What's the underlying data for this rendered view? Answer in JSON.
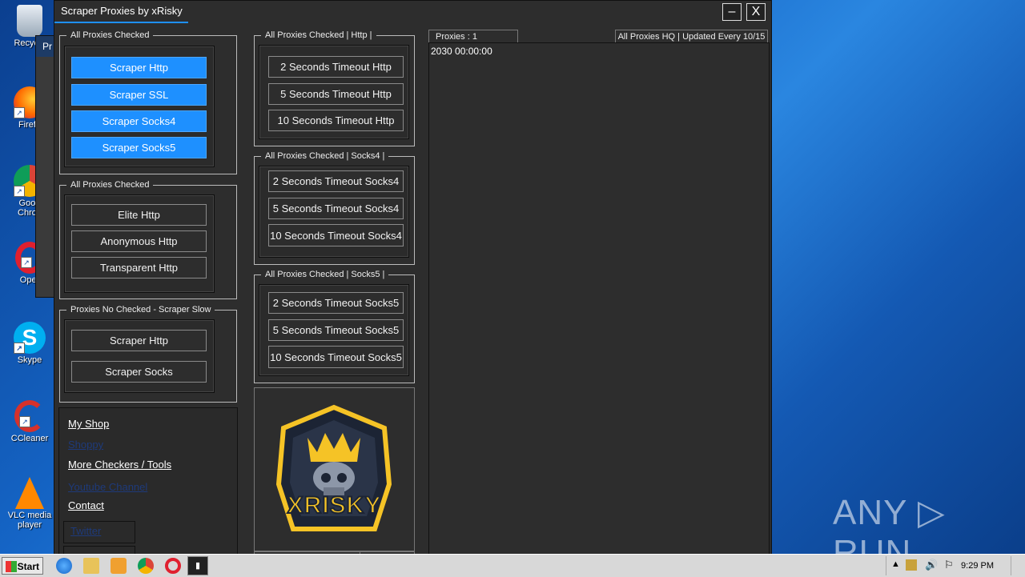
{
  "desktop": {
    "icons": [
      {
        "label": "Recycle",
        "icon": "recycle-bin-icon"
      },
      {
        "label": "Firefo",
        "icon": "firefox-icon"
      },
      {
        "label": "Goog\nChron",
        "icon": "chrome-icon"
      },
      {
        "label": "Oper",
        "icon": "opera-icon"
      },
      {
        "label": "Skype",
        "icon": "skype-icon"
      },
      {
        "label": "CCleaner",
        "icon": "ccleaner-icon"
      },
      {
        "label": "VLC media player",
        "icon": "vlc-icon"
      }
    ],
    "behind_window_title": "Pr"
  },
  "window": {
    "title": "Scraper Proxies by xRisky",
    "minimize": "–",
    "close": "X"
  },
  "group1": {
    "legend": "All Proxies Checked",
    "buttons": [
      "Scraper Http",
      "Scraper SSL",
      "Scraper Socks4",
      "Scraper Socks5"
    ]
  },
  "group2": {
    "legend": "All Proxies Checked",
    "buttons": [
      "Elite Http",
      "Anonymous Http",
      "Transparent Http"
    ]
  },
  "group3": {
    "legend": "Proxies No Checked - Scraper Slow",
    "buttons": [
      "Scraper Http",
      "Scraper Socks"
    ]
  },
  "group_http": {
    "legend": "All Proxies Checked | Http |",
    "buttons": [
      "2 Seconds Timeout Http",
      "5 Seconds Timeout Http",
      "10 Seconds Timeout Http"
    ]
  },
  "group_socks4": {
    "legend": "All Proxies Checked | Socks4 |",
    "buttons": [
      "2 Seconds Timeout Socks4",
      "5 Seconds Timeout Socks4",
      "10 Seconds Timeout Socks4"
    ]
  },
  "group_socks5": {
    "legend": "All Proxies Checked | Socks5 |",
    "buttons": [
      "2 Seconds Timeout Socks5",
      "5 Seconds Timeout Socks5",
      "10 Seconds Timeout Socks5"
    ]
  },
  "links": {
    "my_shop": "My Shop",
    "shoppy": "Shoppy",
    "more_checkers": "More Checkers / Tools",
    "youtube": "Youtube Channel",
    "contact": "Contact",
    "twitter": "Twitter"
  },
  "logo": {
    "text": "XRISKY"
  },
  "output": {
    "count_label": "Proxies : 1",
    "status_label": "All Proxies HQ | Updated Every 10/15",
    "first_line": "2030 00:00:00"
  },
  "watermark": "ANY ▷ RUN",
  "taskbar": {
    "start": "Start",
    "clock": "9:29 PM",
    "pinned": [
      "ie-icon",
      "explorer-icon",
      "media-player-icon",
      "chrome-icon",
      "opera-icon",
      "xrisky-app-icon"
    ]
  },
  "colors": {
    "accent": "#1e90ff",
    "window_bg": "#2d2d2d",
    "logo_gold": "#f5c326"
  }
}
